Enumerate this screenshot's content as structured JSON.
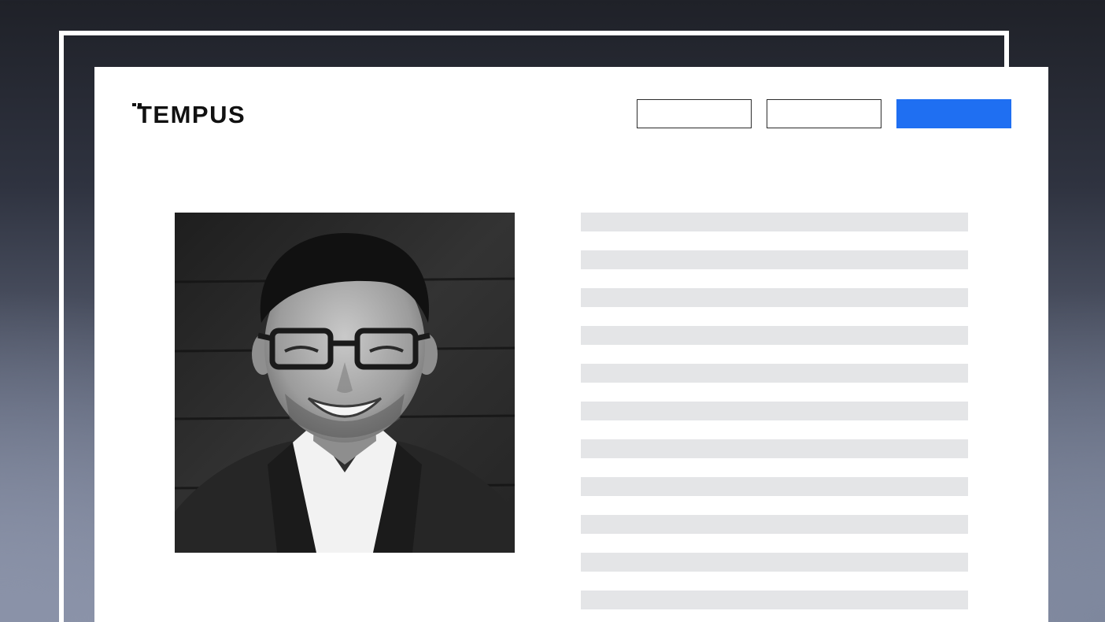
{
  "brand": {
    "name": "TEMPUS",
    "accent_color": "#1f6ff2"
  },
  "header": {
    "nav_buttons": [
      "",
      ""
    ],
    "cta_button": ""
  },
  "profile": {
    "photo_alt": "portrait",
    "text_placeholder_lines": 11
  },
  "colors": {
    "placeholder_line": "#e4e5e7",
    "card_background": "#ffffff"
  }
}
